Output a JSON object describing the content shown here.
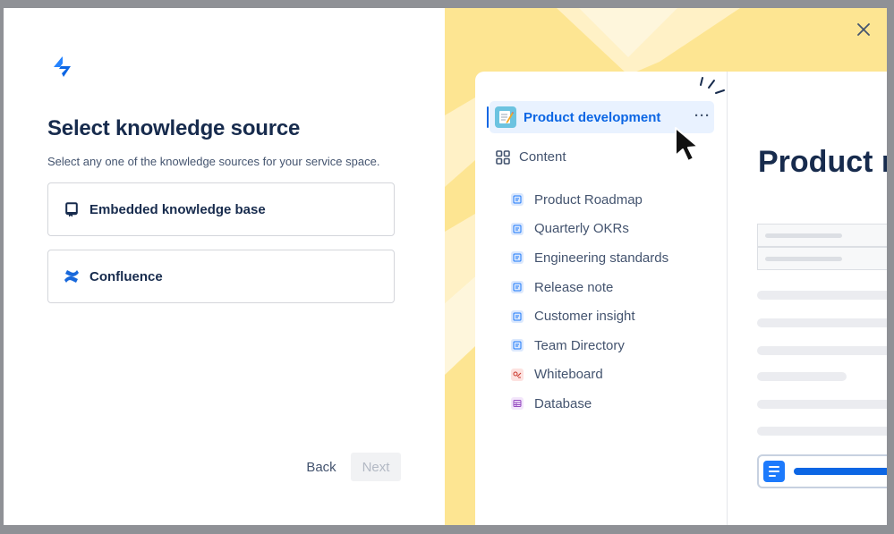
{
  "left": {
    "title": "Select knowledge source",
    "subtitle": "Select any one of the knowledge sources for your service space.",
    "options": [
      {
        "label": "Embedded knowledge base",
        "icon": "book-icon"
      },
      {
        "label": "Confluence",
        "icon": "confluence-logo-icon"
      }
    ],
    "back_label": "Back",
    "next_label": "Next"
  },
  "right": {
    "space_name": "Product development",
    "more_label": "···",
    "content_label": "Content",
    "pages": [
      {
        "label": "Product Roadmap",
        "icon": "page-icon"
      },
      {
        "label": "Quarterly OKRs",
        "icon": "page-icon"
      },
      {
        "label": "Engineering standards",
        "icon": "page-icon"
      },
      {
        "label": "Release note",
        "icon": "page-icon"
      },
      {
        "label": "Customer insight",
        "icon": "page-icon"
      },
      {
        "label": "Team Directory",
        "icon": "page-icon"
      },
      {
        "label": "Whiteboard",
        "icon": "whiteboard-icon"
      },
      {
        "label": "Database",
        "icon": "database-icon"
      }
    ],
    "main_title": "Product ro",
    "link_fragment": "b"
  },
  "colors": {
    "accent": "#0c66e4",
    "illustration_bg": "#fde592",
    "text_primary": "#172b4d",
    "text_secondary": "#44546f"
  }
}
